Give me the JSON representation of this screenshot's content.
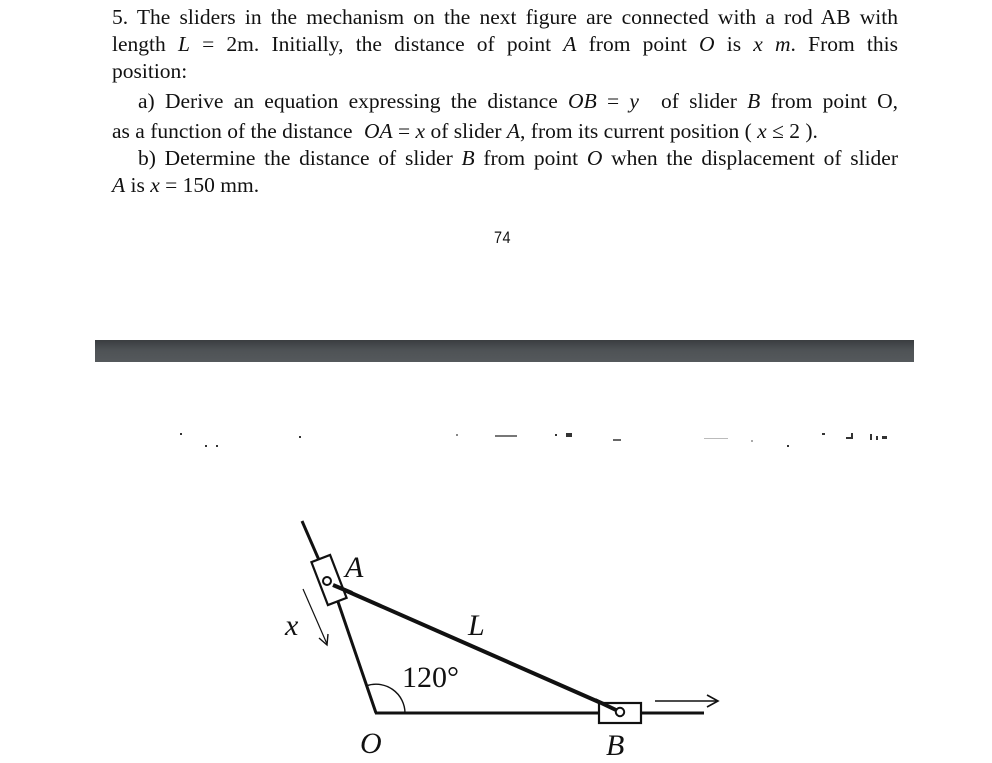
{
  "problem": {
    "line1": "5. The sliders in the mechanism on the next figure are connected with a rod AB with",
    "line2_pre": "length ",
    "line2_L": "L",
    "line2_eq": " = 2",
    "line2_unit": "m. Initially, the distance of point ",
    "line2_A": "A",
    "line2_mid": " from point ",
    "line2_O": "O",
    "line2_is": " is ",
    "line2_x": "x m",
    "line2_end": ". From this",
    "line3": "position:",
    "part_a_pre": "a) Derive an equation expressing the distance ",
    "part_a_OB": "OB",
    "part_a_eq": " = ",
    "part_a_y": "y",
    "part_a_post": "of slider ",
    "part_a_B": "B",
    "part_a_end": " from point O,",
    "part_a2_pre": "as a function of the distance ",
    "part_a2_OA": "OA",
    "part_a2_eq": " = ",
    "part_a2_x": "x",
    "part_a2_mid": " of slider ",
    "part_a2_A": "A",
    "part_a2_post": ", from its current position ( ",
    "part_a2_cond_x": "x",
    "part_a2_cond": " ≤ 2 ).",
    "part_b_pre": "b) Determine the distance of slider ",
    "part_b_B": "B",
    "part_b_mid": " from point ",
    "part_b_O": "O",
    "part_b_end": " when the displacement of slider",
    "part_b2_A": "A",
    "part_b2_is": " is ",
    "part_b2_x": "x",
    "part_b2_val": " = 150  mm."
  },
  "page_number": "74",
  "figure": {
    "label_A": "A",
    "label_x": "x",
    "label_L": "L",
    "label_angle": "120°",
    "label_O": "O",
    "label_B": "B"
  }
}
